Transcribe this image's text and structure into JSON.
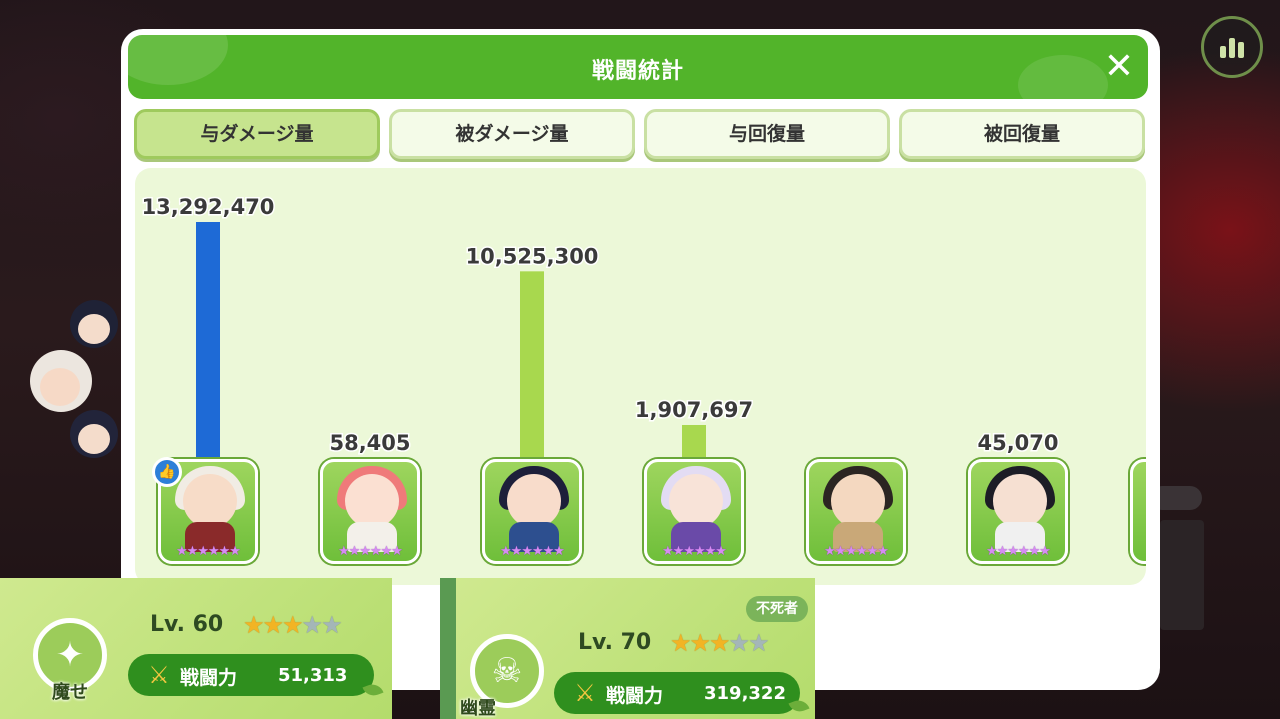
{
  "dialog": {
    "title": "戦闘統計",
    "close_label": "✕"
  },
  "tabs": [
    {
      "label": "与ダメージ量",
      "active": true
    },
    {
      "label": "被ダメージ量",
      "active": false
    },
    {
      "label": "与回復量",
      "active": false
    },
    {
      "label": "被回復量",
      "active": false
    }
  ],
  "chart_data": {
    "type": "bar",
    "categories": [
      "hero-1",
      "hero-2",
      "hero-3",
      "hero-4",
      "hero-5",
      "hero-6"
    ],
    "values": [
      13292470,
      58405,
      10525300,
      1907697,
      0,
      45070
    ],
    "value_labels": [
      "13,292,470",
      "58,405",
      "10,525,300",
      "1,907,697",
      "",
      "45,070"
    ],
    "ylim": [
      0,
      13292470
    ],
    "colors": {
      "highlight": "#1e6ad6",
      "bar": "#a8d84e"
    },
    "highlight_index": 0
  },
  "heroes": [
    {
      "name": "hero-1",
      "hair": "#f1ece4",
      "face": "#f7dcc8",
      "body": "#8a2a2a"
    },
    {
      "name": "hero-2",
      "hair": "#ef7a7a",
      "face": "#fbe0d2",
      "body": "#f3f0ea"
    },
    {
      "name": "hero-3",
      "hair": "#1d1f3a",
      "face": "#f8dccb",
      "body": "#2d4f8f"
    },
    {
      "name": "hero-4",
      "hair": "#e3dcf3",
      "face": "#f8e3d8",
      "body": "#6a4aa8"
    },
    {
      "name": "hero-5",
      "hair": "#2b2522",
      "face": "#f4d8c0",
      "body": "#c9a878"
    },
    {
      "name": "hero-6",
      "hair": "#1c1d26",
      "face": "#f6e0d2",
      "body": "#f0f0f0"
    }
  ],
  "hero_stars": "★★★★★★",
  "left_card": {
    "class_label": "魔せ",
    "class_icon": "star-burst-icon",
    "level": "Lv. 60",
    "stars_on": 3,
    "stars_total": 5,
    "power_label": "戦闘力",
    "power_value": "51,313"
  },
  "right_card": {
    "tag": "不死者",
    "class_label": "幽霊",
    "class_icon": "skull-icon",
    "level": "Lv. 70",
    "stars_on": 3,
    "stars_total": 5,
    "power_label": "戦闘力",
    "power_value": "319,322"
  },
  "icons": {
    "close": "close-icon",
    "stats": "bar-chart-icon",
    "power": "crossed-swords-icon",
    "badge": "thumbs-up-icon"
  }
}
